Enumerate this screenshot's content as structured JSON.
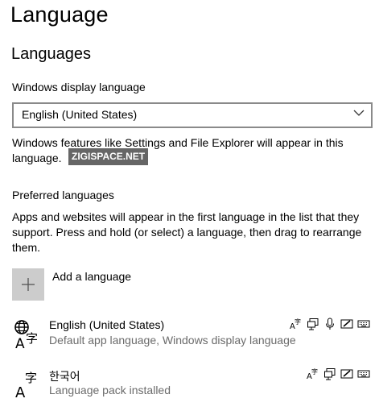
{
  "page": {
    "title": "Language",
    "section_title": "Languages"
  },
  "display_language": {
    "label": "Windows display language",
    "selected": "English (United States)",
    "note": "Windows features like Settings and File Explorer will appear in this language."
  },
  "watermark": "ZIGISPACE.NET",
  "preferred": {
    "label": "Preferred languages",
    "description": "Apps and websites will appear in the first language in the list that they support. Press and hold (or select) a language, then drag to rearrange them.",
    "add_label": "Add a language",
    "languages": [
      {
        "name": "English (United States)",
        "description": "Default app language, Windows display language",
        "feature_icons": [
          "display-language-icon",
          "text-to-speech-icon",
          "speech-recognition-icon",
          "handwriting-icon",
          "keyboard-icon"
        ]
      },
      {
        "name": "한국어",
        "description": "Language pack installed",
        "feature_icons": [
          "display-language-icon",
          "text-to-speech-icon",
          "handwriting-icon",
          "keyboard-icon"
        ]
      }
    ]
  }
}
